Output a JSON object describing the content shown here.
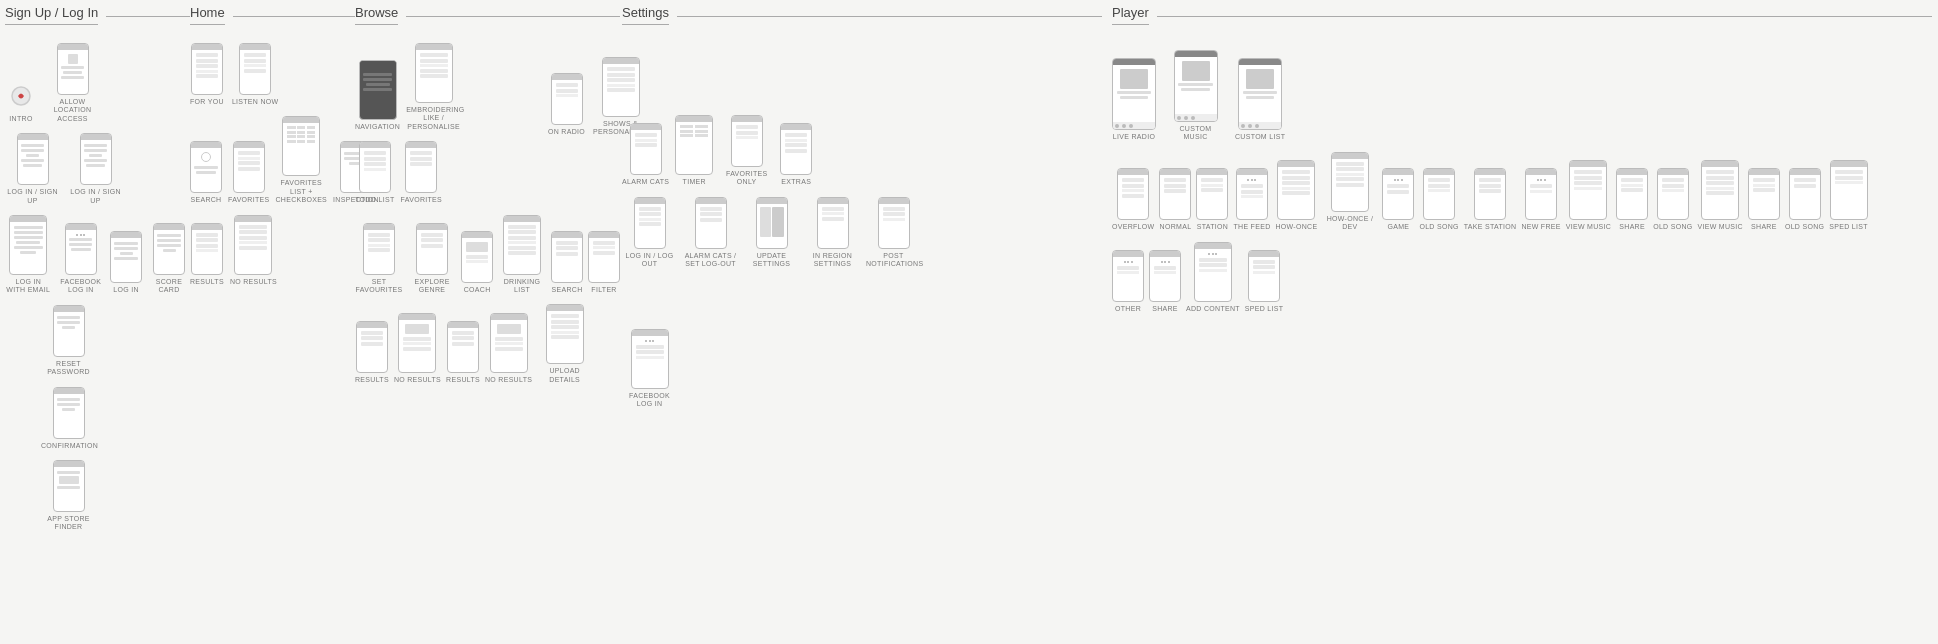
{
  "sections": {
    "signup": {
      "title": "Sign Up / Log In",
      "items": [
        "INTRO",
        "ALLOW LOCATION ACCESS",
        "LOG IN / SIGN UP",
        "LOG IN / SIGN UP",
        "LOG IN WITH EMAIL",
        "FACEBOOK LOG IN",
        "LOG IN",
        "SCORE CARD",
        "RESET PASSWORD",
        "CONFIRMATION",
        "APP STORE FINDER"
      ]
    },
    "home": {
      "title": "Home",
      "items": [
        "FOR YOU",
        "LISTEN NOW",
        "SEARCH",
        "FAVORITES",
        "FAVORITES LIST + CHECKBOXES",
        "INSPECTION",
        "RESULTS",
        "NO RESULTS"
      ]
    },
    "browse": {
      "title": "Browse",
      "items": [
        "NAVIGATION",
        "EMBROIDERING LIKE / PERSONALISE",
        "TODO LIST",
        "FAVORITES",
        "SET FAVOURITES",
        "EXPLORE GENRE",
        "COACH",
        "DRINKING LIST",
        "SEARCH",
        "FILTER",
        "RESULTS",
        "NO RESULTS",
        "RESULTS",
        "NO RESULTS",
        "UPLOAD DETAILS"
      ]
    },
    "browse2": {
      "items": [
        "ON RADIO",
        "SHOWS & PERSONALITIES"
      ]
    },
    "settings": {
      "title": "Settings",
      "items": [
        "ALARM CATS",
        "TIMER",
        "FAVORITES ONLY",
        "EXTRAS",
        "LOG IN / LOG OUT",
        "ALARM CATS / SET LOG-OUT",
        "UPDATE SETTINGS",
        "IN REGION SETTINGS",
        "POST NOTIFICATIONS",
        "FACEBOOK LOG IN"
      ]
    },
    "player": {
      "title": "Player",
      "items": [
        "LIVE RADIO",
        "CUSTOM MUSIC",
        "CUSTOM LIST",
        "OVERFLOW",
        "NORMAL",
        "STATION",
        "THE FEED",
        "HOW-ONCE",
        "HOW-ONCE / DEV",
        "GAME",
        "OLD SONG",
        "TAKE STATION",
        "NEW FREE",
        "VIEW MUSIC",
        "SHARE",
        "OLD SONG",
        "VIEW MUSIC",
        "SHARE",
        "OLD SONG",
        "SPED LIST",
        "OTHER",
        "SHARE",
        "ADD CONTENT",
        "SPED LIST"
      ]
    }
  }
}
